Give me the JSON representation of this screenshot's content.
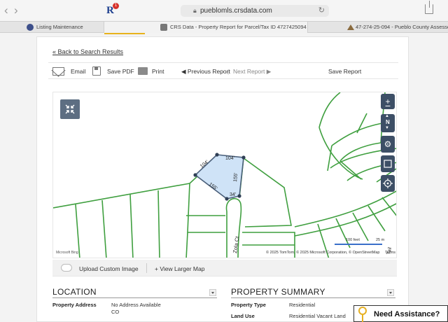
{
  "browser": {
    "url": "pueblomls.crsdata.com",
    "extension_badge": "1",
    "extension_letter": "R"
  },
  "tabs": [
    {
      "label": "Listing Maintenance"
    },
    {
      "label": "CRS Data - Property Report for Parcel/Tax ID 4727425094"
    },
    {
      "label": "47-274-25-094 - Pueblo County Assessor"
    }
  ],
  "report": {
    "back_link": "« Back to Search Results",
    "toolbar": {
      "email": "Email",
      "save_pdf": "Save PDF",
      "print": "Print",
      "previous": "◀ Previous Report",
      "separator": "|",
      "next": "Next Report ▶",
      "save_report": "Save Report"
    }
  },
  "map": {
    "controls": {
      "zoom_in": "+",
      "zoom_out": "−",
      "compass_label": "N"
    },
    "dimensions": [
      "104'",
      "104'",
      "155'",
      "155'",
      "34'"
    ],
    "street_label": "Zola Ct",
    "scale_feet": "100 feet",
    "scale_meters": "25 m",
    "attribution": "© 2025 TomTom, © 2025 Microsoft Corporation, © OpenStreetMap",
    "terms": "Terms",
    "brand": "Microsoft Bing",
    "corner_label": "Tail"
  },
  "map_actions": {
    "upload": "Upload Custom Image",
    "larger": "+ View Larger Map"
  },
  "location": {
    "title": "LOCATION",
    "fields": [
      {
        "label": "Property Address",
        "value": "No Address Available",
        "value2": "CO"
      }
    ]
  },
  "summary": {
    "title": "PROPERTY SUMMARY",
    "fields": [
      {
        "label": "Property Type",
        "value": "Residential"
      },
      {
        "label": "Land Use",
        "value": "Residential Vacant Land"
      }
    ]
  },
  "assistance": {
    "label": "Need Assistance?"
  }
}
